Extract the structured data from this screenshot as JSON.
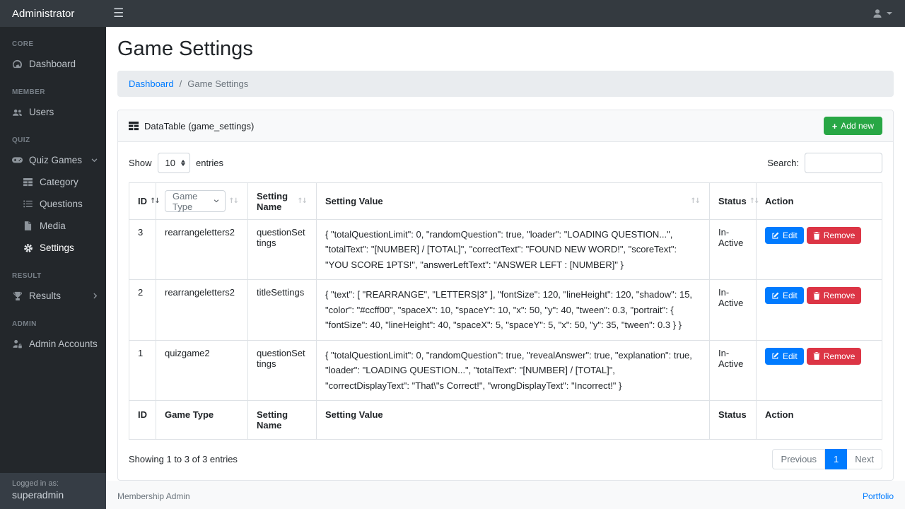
{
  "navbar": {
    "brand": "Administrator"
  },
  "sidebar": {
    "sections": [
      {
        "heading": "CORE",
        "items": [
          {
            "label": "Dashboard"
          }
        ]
      },
      {
        "heading": "MEMBER",
        "items": [
          {
            "label": "Users"
          }
        ]
      },
      {
        "heading": "QUIZ",
        "items": [
          {
            "label": "Quiz Games"
          }
        ]
      },
      {
        "heading": "RESULT",
        "items": [
          {
            "label": "Results"
          }
        ]
      },
      {
        "heading": "ADMIN",
        "items": [
          {
            "label": "Admin Accounts"
          }
        ]
      }
    ],
    "quiz_children": [
      {
        "label": "Category"
      },
      {
        "label": "Questions"
      },
      {
        "label": "Media"
      },
      {
        "label": "Settings",
        "active": true
      }
    ],
    "footer": {
      "logged_in_as": "Logged in as:",
      "username": "superadmin"
    }
  },
  "page": {
    "title": "Game Settings",
    "breadcrumb": {
      "link": "Dashboard",
      "separator": "/",
      "current": "Game Settings"
    }
  },
  "card": {
    "title": "DataTable (game_settings)",
    "add_button": "Add new",
    "add_plus": "+"
  },
  "controls": {
    "show_label": "Show",
    "page_size": "10",
    "entries_label": "entries",
    "search_label": "Search:",
    "search_value": ""
  },
  "table": {
    "headers": {
      "id": "ID",
      "game_type": "Game Type",
      "game_type_filter_placeholder": "Game Type",
      "setting_name": "Setting Name",
      "setting_value": "Setting Value",
      "status": "Status",
      "action": "Action"
    },
    "sort_glyph": "↑↓",
    "edit_label": "Edit",
    "remove_label": "Remove",
    "rows": [
      {
        "id": "3",
        "game_type": "rearrangeletters2",
        "setting_name": "questionSettings",
        "setting_value": "{ \"totalQuestionLimit\": 0, \"randomQuestion\": true, \"loader\": \"LOADING QUESTION...\", \"totalText\": \"[NUMBER] / [TOTAL]\", \"correctText\": \"FOUND NEW WORD!\", \"scoreText\": \"YOU SCORE 1PTS!\", \"answerLeftText\": \"ANSWER LEFT : [NUMBER]\" }",
        "status": "In-Active"
      },
      {
        "id": "2",
        "game_type": "rearrangeletters2",
        "setting_name": "titleSettings",
        "setting_value": "{ \"text\": [ \"REARRANGE\", \"LETTERS|3\" ], \"fontSize\": 120, \"lineHeight\": 120, \"shadow\": 15, \"color\": \"#ccff00\", \"spaceX\": 10, \"spaceY\": 10, \"x\": 50, \"y\": 40, \"tween\": 0.3, \"portrait\": { \"fontSize\": 40, \"lineHeight\": 40, \"spaceX\": 5, \"spaceY\": 5, \"x\": 50, \"y\": 35, \"tween\": 0.3 } }",
        "status": "In-Active"
      },
      {
        "id": "1",
        "game_type": "quizgame2",
        "setting_name": "questionSettings",
        "setting_value": "{ \"totalQuestionLimit\": 0, \"randomQuestion\": true, \"revealAnswer\": true, \"explanation\": true, \"loader\": \"LOADING QUESTION...\", \"totalText\": \"[NUMBER] / [TOTAL]\", \"correctDisplayText\": \"That\\\"s Correct!\", \"wrongDisplayText\": \"Incorrect!\" }",
        "status": "In-Active"
      }
    ]
  },
  "summary": "Showing 1 to 3 of 3 entries",
  "pagination": {
    "previous": "Previous",
    "page": "1",
    "next": "Next"
  },
  "footer": {
    "left": "Membership Admin",
    "right_link": "Portfolio"
  },
  "colors": {
    "navbar_bg": "#343a40",
    "sidebar_bg": "#23272b",
    "accent_green": "#28a745",
    "edit_blue": "#007bff",
    "remove_red": "#dc3545",
    "link_blue": "#007bff",
    "breadcrumb_bg": "#e9ecef"
  }
}
